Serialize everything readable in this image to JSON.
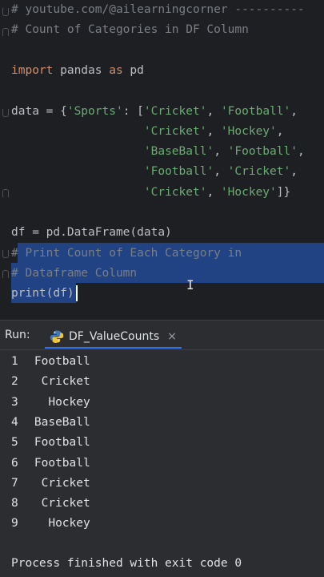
{
  "editor": {
    "lines": [
      {
        "parts": [
          {
            "t": "cm",
            "v": "# youtube.com/@ailearningcorner ----------"
          }
        ]
      },
      {
        "parts": [
          {
            "t": "cm",
            "v": "# Count of Categories in DF Column"
          }
        ]
      },
      {
        "parts": []
      },
      {
        "parts": [
          {
            "t": "kw",
            "v": "import"
          },
          {
            "t": "tx",
            "v": " pandas "
          },
          {
            "t": "kw",
            "v": "as"
          },
          {
            "t": "tx",
            "v": " pd"
          }
        ]
      },
      {
        "parts": []
      },
      {
        "parts": [
          {
            "t": "tx",
            "v": "data = {"
          },
          {
            "t": "st",
            "v": "'Sports'"
          },
          {
            "t": "tx",
            "v": ": ["
          },
          {
            "t": "st",
            "v": "'Cricket'"
          },
          {
            "t": "tx",
            "v": ", "
          },
          {
            "t": "st",
            "v": "'Football'"
          },
          {
            "t": "tx",
            "v": ","
          }
        ]
      },
      {
        "parts": [
          {
            "t": "tx",
            "v": "                   "
          },
          {
            "t": "st",
            "v": "'Cricket'"
          },
          {
            "t": "tx",
            "v": ", "
          },
          {
            "t": "st",
            "v": "'Hockey'"
          },
          {
            "t": "tx",
            "v": ","
          }
        ]
      },
      {
        "parts": [
          {
            "t": "tx",
            "v": "                   "
          },
          {
            "t": "st",
            "v": "'BaseBall'"
          },
          {
            "t": "tx",
            "v": ", "
          },
          {
            "t": "st",
            "v": "'Football'"
          },
          {
            "t": "tx",
            "v": ","
          }
        ]
      },
      {
        "parts": [
          {
            "t": "tx",
            "v": "                   "
          },
          {
            "t": "st",
            "v": "'Football'"
          },
          {
            "t": "tx",
            "v": ", "
          },
          {
            "t": "st",
            "v": "'Cricket'"
          },
          {
            "t": "tx",
            "v": ","
          }
        ]
      },
      {
        "parts": [
          {
            "t": "tx",
            "v": "                   "
          },
          {
            "t": "st",
            "v": "'Cricket'"
          },
          {
            "t": "tx",
            "v": ", "
          },
          {
            "t": "st",
            "v": "'Hockey'"
          },
          {
            "t": "tx",
            "v": "]}"
          }
        ]
      },
      {
        "parts": []
      },
      {
        "parts": [
          {
            "t": "tx",
            "v": "df = pd.DataFrame(data)"
          }
        ]
      },
      {
        "parts": [
          {
            "t": "cm",
            "v": "# Print Count of Each Category in"
          }
        ]
      },
      {
        "parts": [
          {
            "t": "cm",
            "v": "# Dataframe Column"
          }
        ]
      },
      {
        "parts": [
          {
            "t": "tx",
            "v": "print(df)"
          }
        ]
      }
    ],
    "colors": {
      "comment": "#7a7e85",
      "keyword": "#cf8e6d",
      "string": "#6aab73",
      "text": "#bcbec4",
      "selection": "#214283"
    }
  },
  "run_panel": {
    "label": "Run:",
    "tab_label": "DF_ValueCounts",
    "tab_icon": "python-icon",
    "close_icon": "close-icon",
    "close_glyph": "×"
  },
  "console": {
    "rows": [
      {
        "index": "1",
        "value": "Football"
      },
      {
        "index": "2",
        "value": "Cricket"
      },
      {
        "index": "3",
        "value": "Hockey"
      },
      {
        "index": "4",
        "value": "BaseBall"
      },
      {
        "index": "5",
        "value": "Football"
      },
      {
        "index": "6",
        "value": "Football"
      },
      {
        "index": "7",
        "value": "Cricket"
      },
      {
        "index": "8",
        "value": "Cricket"
      },
      {
        "index": "9",
        "value": "Hockey"
      }
    ],
    "footer": "Process finished with exit code 0"
  }
}
